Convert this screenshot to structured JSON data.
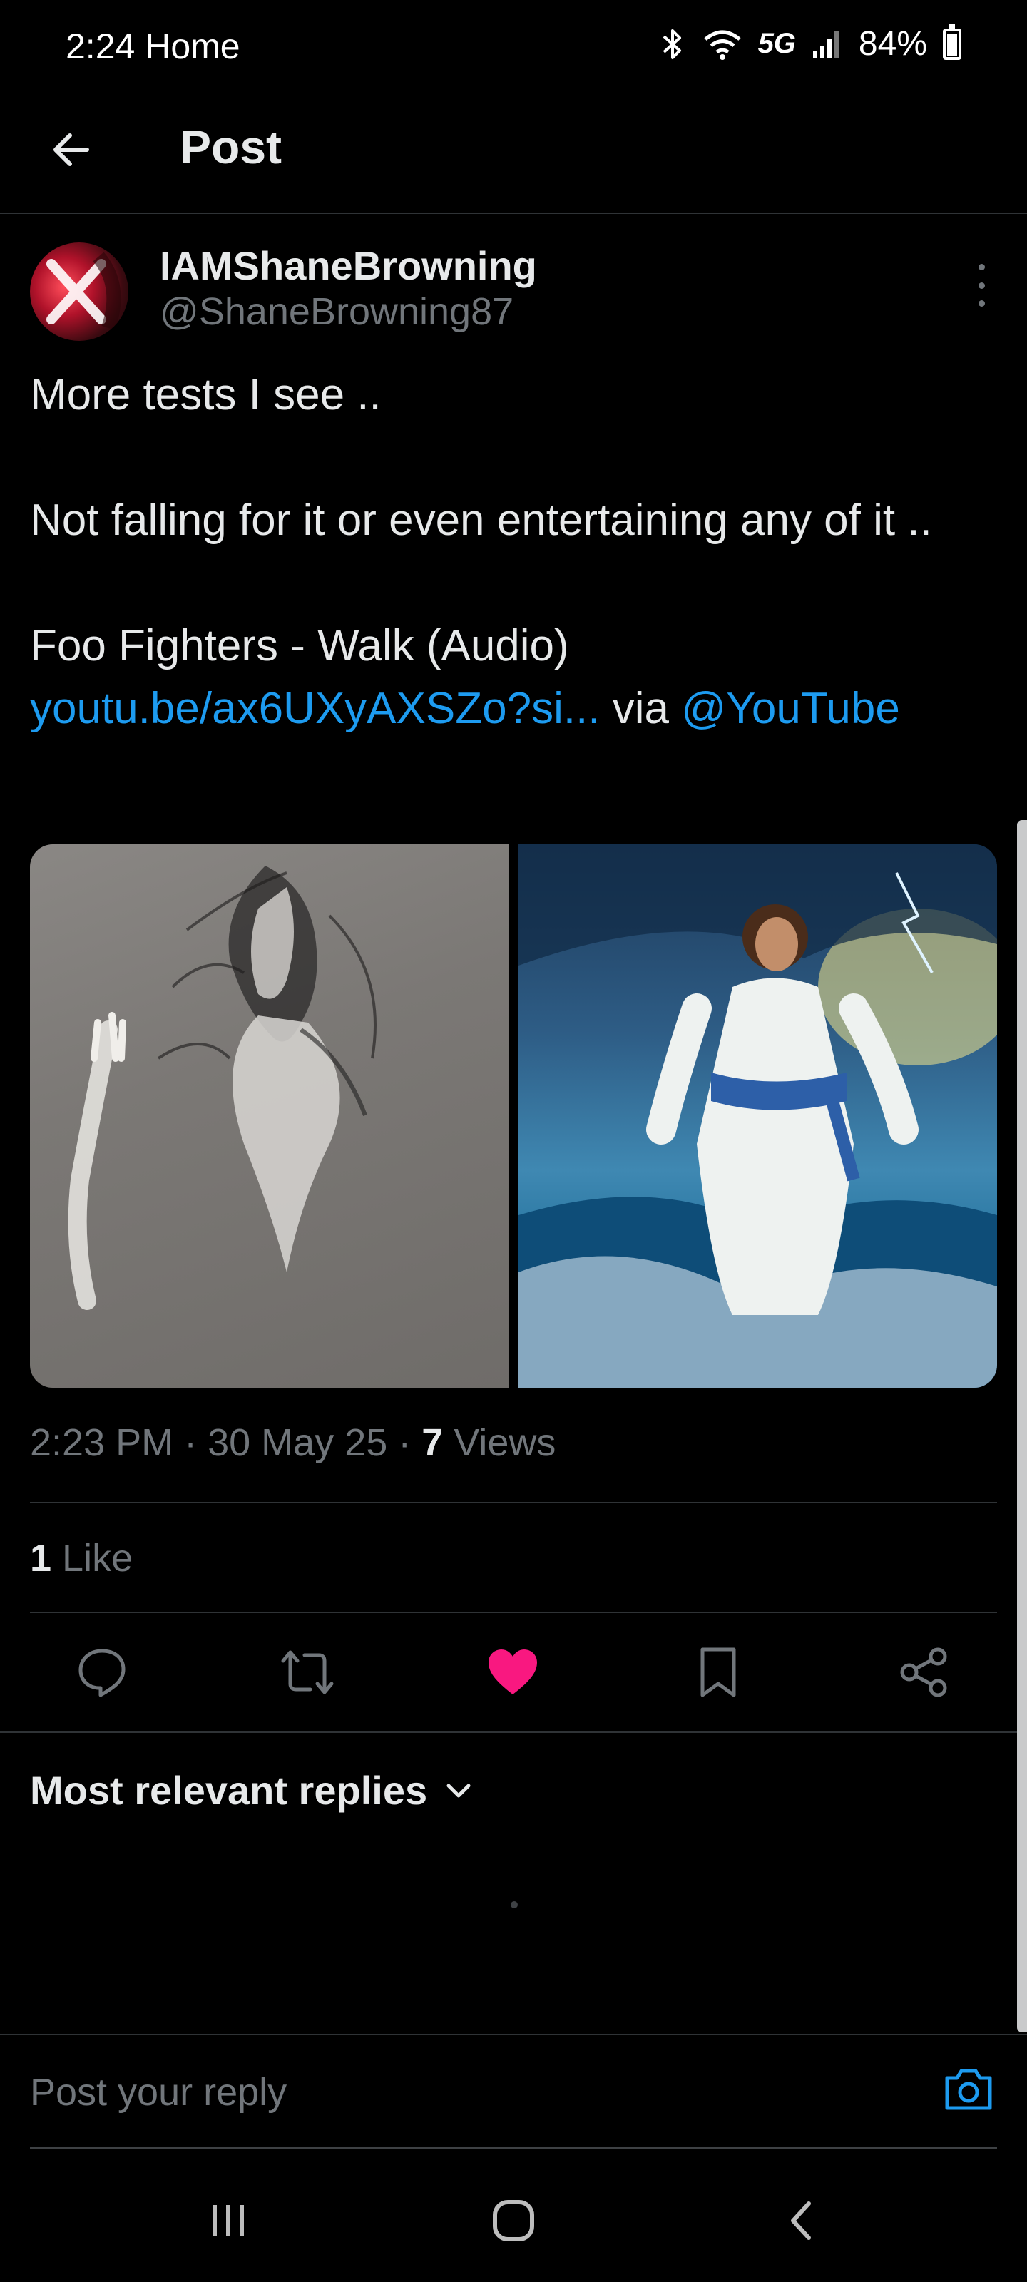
{
  "status_bar": {
    "time": "2:24 Home",
    "network": "5G",
    "battery": "84%",
    "battery_level": 0.84
  },
  "header": {
    "title": "Post"
  },
  "post": {
    "author": {
      "name": "IAMShaneBrowning",
      "handle": "@ShaneBrowning87"
    },
    "text": {
      "line1": "More tests I see ..",
      "line2": "Not falling for it or even entertaining any of it ..",
      "line3_prefix": "Foo Fighters - Walk (Audio) ",
      "link_text": "youtu.be/ax6UXyAXSZo?si...",
      "via": " via ",
      "mention": "@YouTube"
    },
    "meta": {
      "time": "2:23 PM",
      "separator": " · ",
      "date": "30 May 25",
      "views_count": "7",
      "views_label": " Views"
    },
    "likes": {
      "count": "1",
      "label": " Like"
    },
    "liked": true
  },
  "replies": {
    "filter_label": "Most relevant replies"
  },
  "reply_bar": {
    "placeholder": "Post your reply"
  },
  "icons": {
    "back": "arrow-left-icon",
    "more": "more-vertical-icon",
    "reply": "chat-bubble-icon",
    "repost": "repost-icon",
    "like": "heart-filled-icon",
    "bookmark": "bookmark-icon",
    "share": "share-icon",
    "camera": "camera-icon"
  },
  "colors": {
    "background": "#000000",
    "text_primary": "#e7e9ea",
    "text_secondary": "#71767b",
    "link": "#1d9bf0",
    "like": "#f91880",
    "divider": "#2f3336"
  }
}
